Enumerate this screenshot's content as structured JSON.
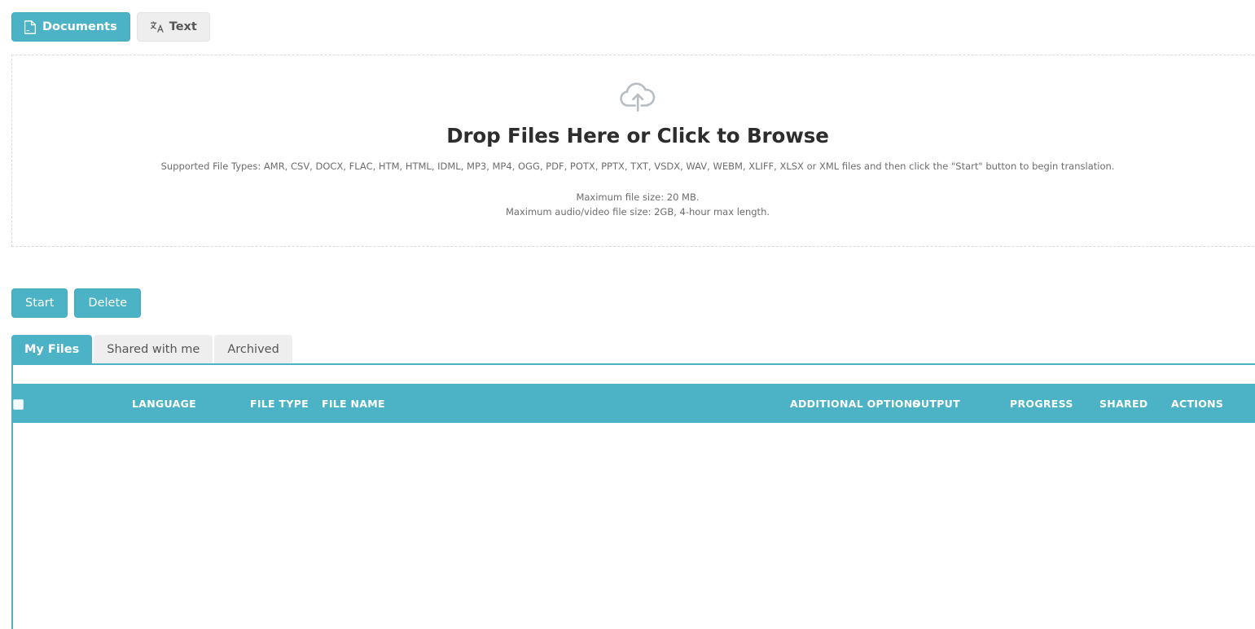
{
  "mode_tabs": [
    {
      "label": "Documents",
      "icon": "document-icon",
      "active": true
    },
    {
      "label": "Text",
      "icon": "translate-icon",
      "active": false
    }
  ],
  "dropzone": {
    "icon": "cloud-upload-icon",
    "title": "Drop Files Here or Click to Browse",
    "supported_types": "Supported File Types: AMR, CSV, DOCX, FLAC, HTM, HTML, IDML, MP3, MP4, OGG, PDF, POTX, PPTX, TXT, VSDX, WAV, WEBM, XLIFF, XLSX or XML files and then click the \"Start\" button to begin translation.",
    "max_file_size": "Maximum file size: 20 MB.",
    "max_av_size": "Maximum audio/video file size: 2GB, 4-hour max length."
  },
  "actions": {
    "start_label": "Start",
    "delete_label": "Delete"
  },
  "file_tabs": [
    {
      "label": "My Files",
      "active": true
    },
    {
      "label": "Shared with me",
      "active": false
    },
    {
      "label": "Archived",
      "active": false
    }
  ],
  "files_table": {
    "columns": [
      "",
      "LANGUAGE",
      "FILE TYPE",
      "FILE NAME",
      "ADDITIONAL OPTIONS",
      "OUTPUT",
      "PROGRESS",
      "SHARED",
      "ACTIONS"
    ],
    "rows": []
  },
  "colors": {
    "accent": "#4cb3c6",
    "accent_border": "#45aabd",
    "tab_inactive": "#eeeeee",
    "text": "#333333",
    "muted_text": "#6d6d6d",
    "dropzone_border": "#d9d9d9"
  }
}
